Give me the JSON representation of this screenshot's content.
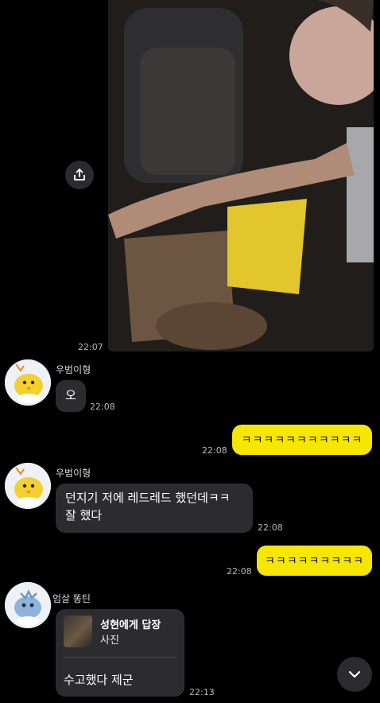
{
  "messages": {
    "photo_time": "22:07",
    "m1": {
      "sender": "우범이형",
      "text": "오",
      "time": "22:08"
    },
    "m2": {
      "text": "ㅋㅋㅋㅋㅋㅋㅋㅋㅋㅋㅋ",
      "time": "22:08"
    },
    "m3": {
      "sender": "우범이형",
      "line1": "던지기 저에 레드레드 했던데ㅋㅋ",
      "line2": "잘 했다",
      "time": "22:08"
    },
    "m4": {
      "text": "ㅋㅋㅋㅋㅋㅋㅋㅋㅋ",
      "time": "22:08"
    },
    "m5": {
      "sender": "엄살 똥틴",
      "reply_target": "성현에게 답장",
      "reply_preview": "사진",
      "text": "수고했다 제군",
      "time": "22:13"
    }
  },
  "icons": {
    "share": "share-icon",
    "scroll_down": "chevron-down-icon",
    "avatar1": "chick-avatar-icon",
    "avatar3": "fish-avatar-icon"
  },
  "colors": {
    "background": "#000000",
    "incoming_bubble": "#2c2c2e",
    "outgoing_bubble": "#f7e600",
    "timestamp": "#b6b6b6"
  }
}
